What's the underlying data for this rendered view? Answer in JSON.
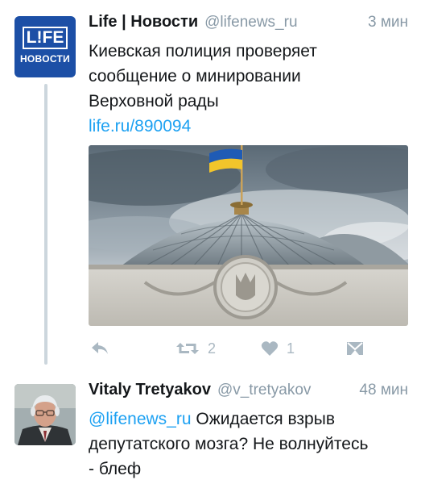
{
  "tweets": [
    {
      "author_name": "Life | Новости",
      "handle": "@lifenews_ru",
      "time": "3 мин",
      "avatar_text": "L!FE",
      "avatar_subtext": "НОВОСТИ",
      "text_lines": [
        "Киевская полиция проверяет",
        "сообщение о минировании",
        "Верховной рады"
      ],
      "link": "life.ru/890094",
      "retweets": "2",
      "likes": "1",
      "icons": [
        "reply-icon",
        "retweet-icon",
        "heart-icon",
        "dm-icon"
      ]
    },
    {
      "author_name": "Vitaly Tretyakov",
      "handle": "@v_tretyakov",
      "time": "48 мин",
      "mention": "@lifenews_ru",
      "text_line1_rest": " Ожидается взрыв",
      "text_line2": "депутатского мозга? Не волнуйтесь",
      "text_line3": "- блеф"
    }
  ],
  "colors": {
    "link": "#1da1f2",
    "muted": "#8899a6",
    "life_blue": "#1c4fa6"
  }
}
